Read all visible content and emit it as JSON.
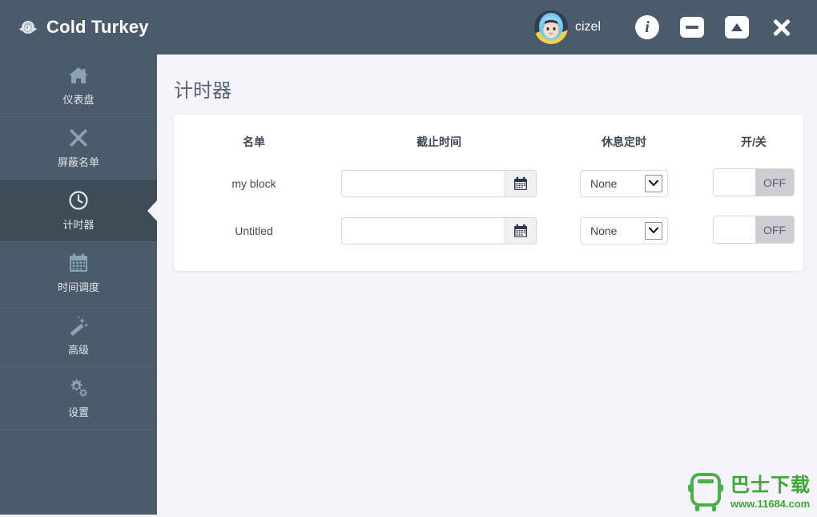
{
  "titlebar": {
    "app_name": "Cold Turkey",
    "logo_icon": "turkey-icon",
    "user": {
      "name": "cizel",
      "avatar_icon": "user-avatar"
    },
    "buttons": [
      {
        "name": "info-button",
        "icon": "info-icon",
        "label": "i"
      },
      {
        "name": "minimize-button",
        "icon": "minimize-icon",
        "label": ""
      },
      {
        "name": "maximize-button",
        "icon": "maximize-icon",
        "label": ""
      },
      {
        "name": "close-button",
        "icon": "close-icon",
        "label": ""
      }
    ]
  },
  "sidebar": {
    "items": [
      {
        "label": "仪表盘",
        "icon": "home-icon",
        "active": false
      },
      {
        "label": "屏蔽名单",
        "icon": "x-mark-icon",
        "active": false
      },
      {
        "label": "计时器",
        "icon": "clock-icon",
        "active": true
      },
      {
        "label": "时间调度",
        "icon": "calendar-icon",
        "active": false
      },
      {
        "label": "高级",
        "icon": "magic-wand-icon",
        "active": false
      },
      {
        "label": "设置",
        "icon": "gears-icon",
        "active": false
      }
    ]
  },
  "main": {
    "page_title": "计时器",
    "table": {
      "headers": [
        "名单",
        "截止时间",
        "休息定时",
        "开/关"
      ],
      "rows": [
        {
          "name": "my block",
          "due_time_value": "",
          "due_time_placeholder": "",
          "calendar_icon": "calendar-icon",
          "break_timer": "None",
          "toggle_state": "OFF"
        },
        {
          "name": "Untitled",
          "due_time_value": "",
          "due_time_placeholder": "",
          "calendar_icon": "calendar-icon",
          "break_timer": "None",
          "toggle_state": "OFF"
        }
      ]
    }
  },
  "watermark": {
    "brand_cn": "巴士下载",
    "url": "www.11684.com",
    "logo_icon": "bus-logo-icon",
    "color": "#3fa535"
  },
  "colors": {
    "titlebar_bg": "#4b5b6b",
    "sidebar_bg": "#4b5b6b",
    "sidebar_active_bg": "#3e4c58",
    "content_bg": "#f5f4fa",
    "card_bg": "#ffffff",
    "sidebar_icon": "#8ba3b8",
    "text_light": "#dfe5ea"
  }
}
